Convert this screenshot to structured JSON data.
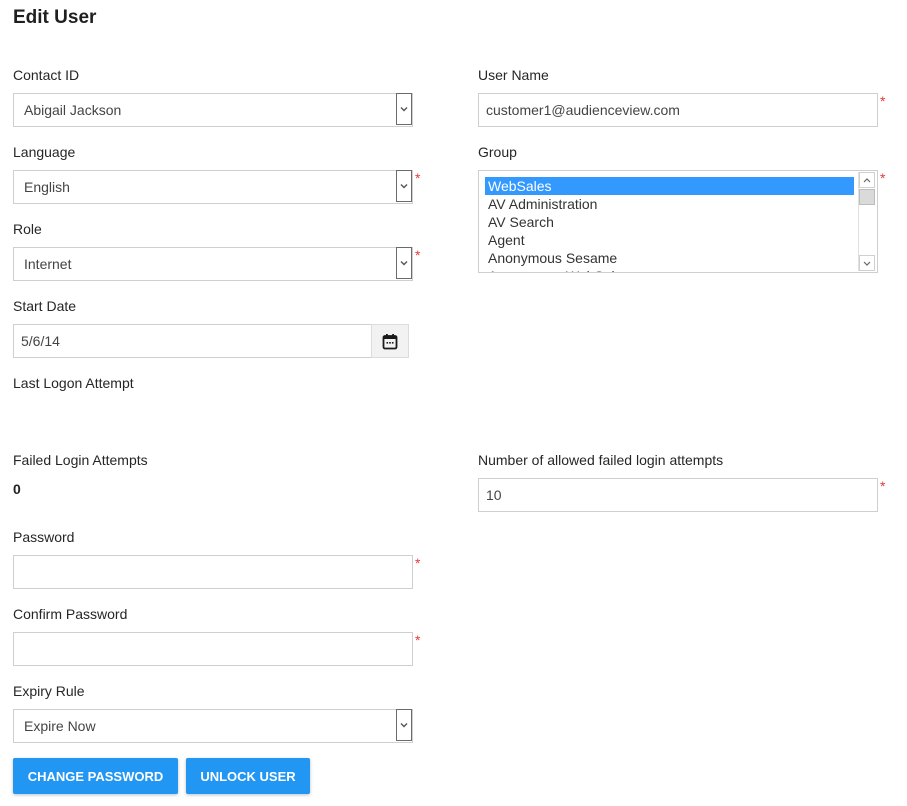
{
  "page": {
    "title": "Edit User"
  },
  "fields": {
    "contact_id": {
      "label": "Contact ID",
      "value": "Abigail Jackson",
      "required": false
    },
    "user_name": {
      "label": "User Name",
      "value": "customer1@audienceview.com",
      "required": true
    },
    "language": {
      "label": "Language",
      "value": "English",
      "required": true
    },
    "group": {
      "label": "Group",
      "required": true,
      "options": [
        "WebSales",
        "AV Administration",
        "AV Search",
        "Agent",
        "Anonymous Sesame",
        "Anonymous WebSales"
      ],
      "selected": "WebSales"
    },
    "role": {
      "label": "Role",
      "value": "Internet",
      "required": true
    },
    "start_date": {
      "label": "Start Date",
      "value": "5/6/14",
      "icon": "calendar-icon"
    },
    "last_logon_attempt": {
      "label": "Last Logon Attempt",
      "value": ""
    },
    "failed_login_attempts": {
      "label": "Failed Login Attempts",
      "value": "0"
    },
    "allowed_failed_attempts": {
      "label": "Number of allowed failed login attempts",
      "value": "10",
      "required": true
    },
    "password": {
      "label": "Password",
      "value": "",
      "required": true
    },
    "confirm_password": {
      "label": "Confirm Password",
      "value": "",
      "required": true
    },
    "expiry_rule": {
      "label": "Expiry Rule",
      "value": "Expire Now",
      "required": false
    }
  },
  "required_marker": "*",
  "buttons": {
    "change_password": "CHANGE PASSWORD",
    "unlock_user": "UNLOCK USER"
  },
  "colors": {
    "accent": "#2196f3",
    "required": "#e53935",
    "selection": "#3399ff"
  }
}
